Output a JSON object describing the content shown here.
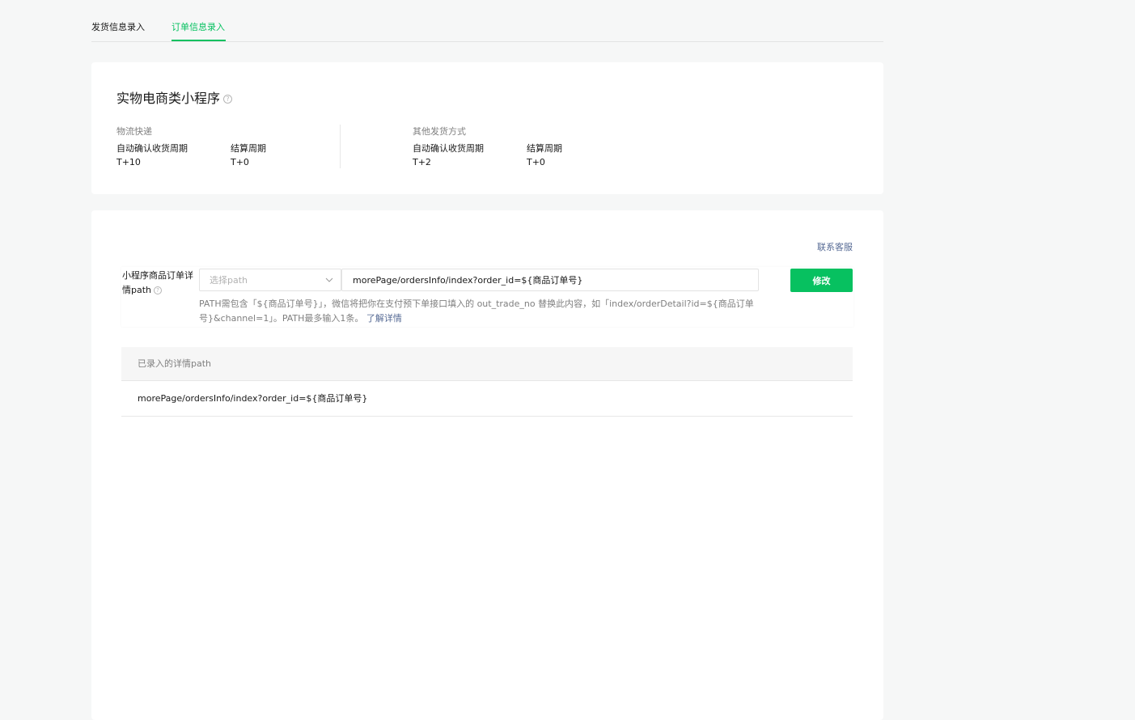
{
  "tabs": [
    {
      "label": "发货信息录入",
      "active": false
    },
    {
      "label": "订单信息录入",
      "active": true
    }
  ],
  "accent_color": "#07c160",
  "link_color": "#576b95",
  "summary": {
    "title": "实物电商类小程序",
    "groups": [
      {
        "label": "物流快递",
        "metrics": [
          {
            "label": "自动确认收货周期",
            "value": "T+10"
          },
          {
            "label": "结算周期",
            "value": "T+0"
          }
        ]
      },
      {
        "label": "其他发货方式",
        "metrics": [
          {
            "label": "自动确认收货周期",
            "value": "T+2"
          },
          {
            "label": "结算周期",
            "value": "T+0"
          }
        ]
      }
    ]
  },
  "detail": {
    "contact_label": "联系客服",
    "field_label": "小程序商品订单详情path",
    "select_placeholder": "选择path",
    "path_value": "morePage/ordersInfo/index?order_id=${商品订单号}",
    "submit_label": "修改",
    "hint_text": "PATH需包含「${商品订单号}」，微信将把你在支付预下单接口填入的 out_trade_no 替换此内容，如「index/orderDetail?id=${商品订单号}&channel=1」。PATH最多输入1条。",
    "hint_link": "了解详情",
    "table": {
      "header": "已录入的详情path",
      "rows": [
        "morePage/ordersInfo/index?order_id=${商品订单号}"
      ]
    }
  }
}
